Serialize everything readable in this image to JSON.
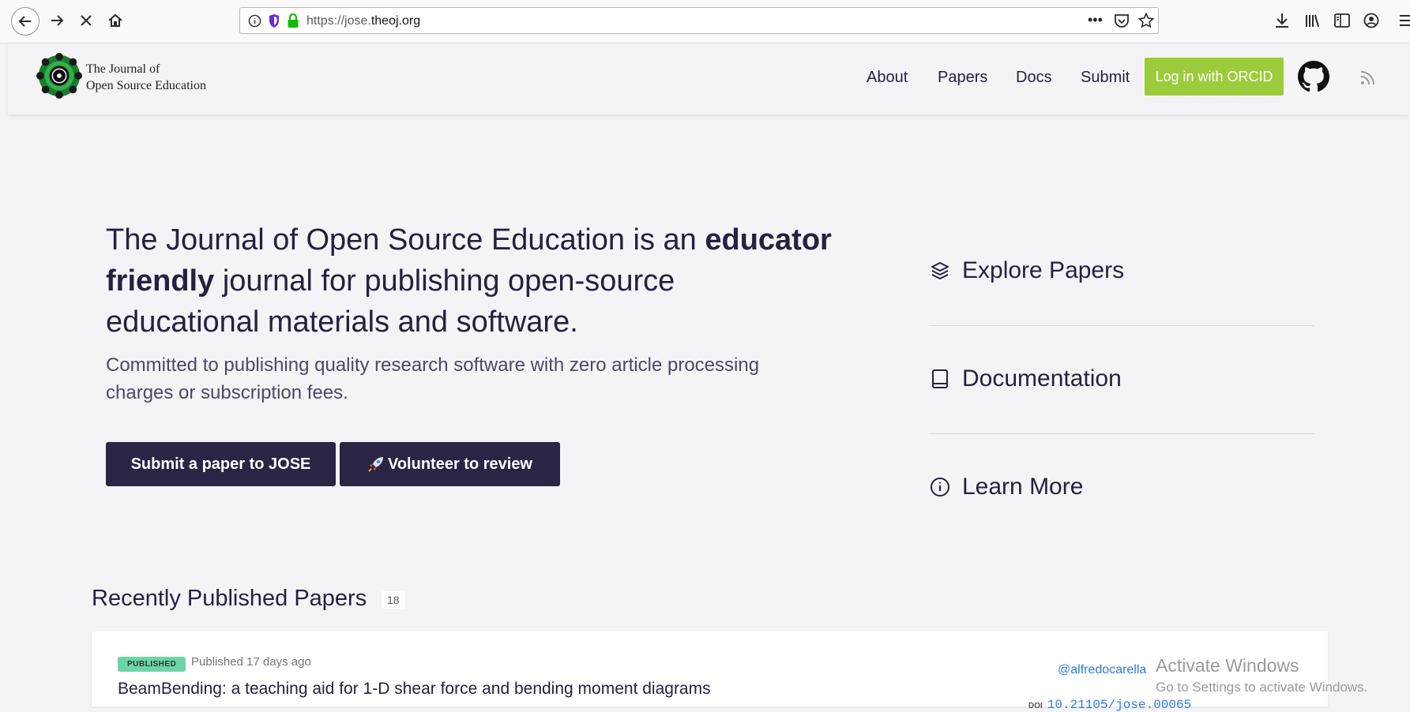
{
  "browser": {
    "url_prefix": "https://jose.",
    "url_domain": "theoj.org"
  },
  "site": {
    "logo_line1": "The Journal of",
    "logo_line2": "Open Source Education",
    "nav": [
      "About",
      "Papers",
      "Docs",
      "Submit"
    ],
    "orcid_label": "Log in with ORCID"
  },
  "hero": {
    "title_part1": "The Journal of Open Source Education is an",
    "title_strong": "educator friendly",
    "title_part2": "journal for publishing open-source educational materials and software.",
    "subtitle": "Committed to publishing quality research software with zero article processing charges or subscription fees.",
    "submit_button": "Submit a paper to JOSE",
    "volunteer_button": "Volunteer to review"
  },
  "side_links": {
    "explore": "Explore Papers",
    "docs": "Documentation",
    "learn": "Learn More"
  },
  "recent": {
    "title": "Recently Published Papers",
    "count": "18",
    "paper": {
      "status": "PUBLISHED",
      "published": "Published 17 days ago",
      "title": "BeamBending: a teaching aid for 1-D shear force and bending moment diagrams",
      "author": "@alfredocarella",
      "doi_label": "DOI",
      "doi": "10.21105/jose.00065"
    }
  },
  "watermark": {
    "line1": "Activate Windows",
    "line2": "Go to Settings to activate Windows."
  },
  "colors": {
    "brand_dark": "#2a2545",
    "orcid_green": "#9ccc3c",
    "published_badge": "#6fd3a8",
    "link_blue": "#2c7be5"
  }
}
